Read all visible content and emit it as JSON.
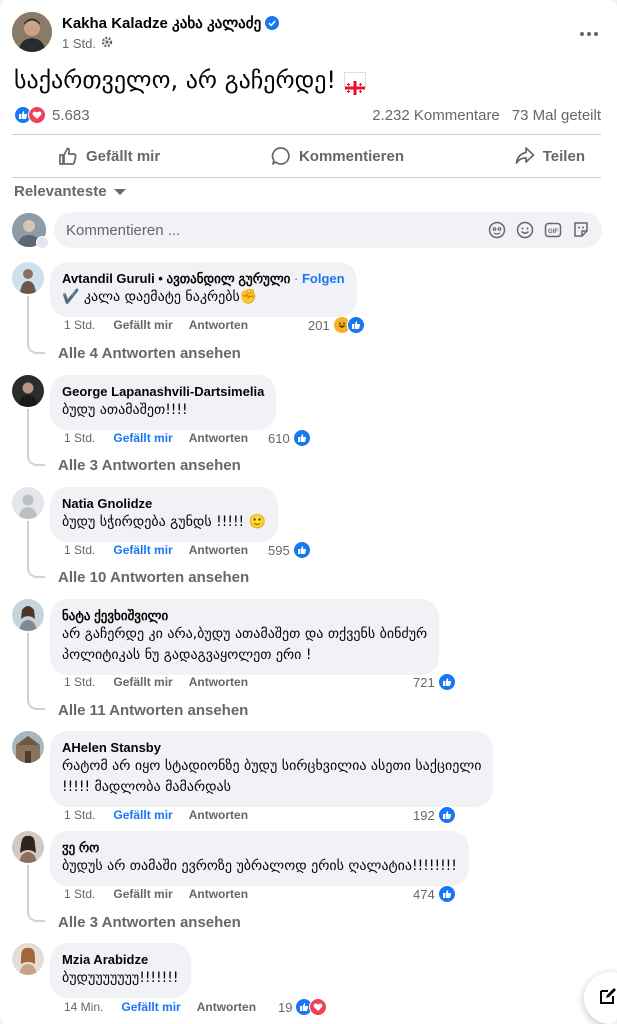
{
  "post": {
    "author": "Kakha Kaladze კახა კალაძე",
    "time": "1 Std.",
    "text": "საქართველო, არ გაჩერდე!",
    "reaction_count": "5.683",
    "comments_count": "2.232 Kommentare",
    "shares_count": "73 Mal geteilt"
  },
  "actions": {
    "like": "Gefällt mir",
    "comment": "Kommentieren",
    "share": "Teilen"
  },
  "sort_label": "Relevanteste",
  "composer": {
    "placeholder": "Kommentieren ..."
  },
  "comments": [
    {
      "name": "Avtandil Guruli • ავთანდილ გურული",
      "follow_sep": " · ",
      "follow": "Folgen",
      "text": "✔️ კალა დაემატე ნაკრებს✊",
      "time": "1 Std.",
      "like": "Gefällt mir",
      "reply": "Antworten",
      "reactions": "201",
      "replies": "Alle 4 Antworten ansehen"
    },
    {
      "name": "George Lapanashvili-Dartsimelia",
      "text": "ბუდუ ათამაშეთ!!!!",
      "time": "1 Std.",
      "like": "Gefällt mir",
      "reply": "Antworten",
      "reactions": "610",
      "replies": "Alle 3 Antworten ansehen"
    },
    {
      "name": "Natia Gnolidze",
      "text": "ბუდუ სჭირდება გუნდს !!!!! 🙂",
      "time": "1 Std.",
      "like": "Gefällt mir",
      "reply": "Antworten",
      "reactions": "595",
      "replies": "Alle 10 Antworten ansehen"
    },
    {
      "name": "ნატა ქევხიშვილი",
      "text_lines": [
        "არ გაჩერდე კი არა,ბუდუ ათამაშეთ და თქვენს ბინძურ",
        "პოლიტიკას ნუ გადაგვაყოლეთ ერი !"
      ],
      "time": "1 Std.",
      "like": "Gefällt mir",
      "reply": "Antworten",
      "reactions": "721",
      "replies": "Alle 11 Antworten ansehen"
    },
    {
      "name": "AHelen Stansby",
      "text_lines": [
        "რატომ არ იყო სტადიონზე ბუდუ სირცხვილია ასეთი საქციელი",
        "!!!!! მადლობა მამარდას"
      ],
      "time": "1 Std.",
      "like": "Gefällt mir",
      "reply": "Antworten",
      "reactions": "192"
    },
    {
      "name": "ჳე რო",
      "text": "ბუდუს არ თამაში ევროზე უბრალოდ ერის ღალატია!!!!!!!!",
      "time": "1 Std.",
      "like": "Gefällt mir",
      "reply": "Antworten",
      "reactions": "474",
      "replies": "Alle 3 Antworten ansehen"
    },
    {
      "name": "Mzia Arabidze",
      "text": "ბუდუუუუუუუ!!!!!!!",
      "time": "14 Min.",
      "like": "Gefällt mir",
      "reply": "Antworten",
      "reactions": "19"
    }
  ],
  "colors": {
    "accent": "#1877f2",
    "love": "#f33e58",
    "haha": "#f7b125",
    "secondary_text": "#65676b",
    "bubble": "#f0f2f5"
  },
  "icons": [
    "verified-icon",
    "gear-icon",
    "more-icon",
    "like-icon",
    "comment-icon",
    "share-icon",
    "caret-down-icon",
    "emoji-icon",
    "sticker-icon",
    "gif-icon",
    "compose-icon",
    "flag-georgia-icon"
  ]
}
